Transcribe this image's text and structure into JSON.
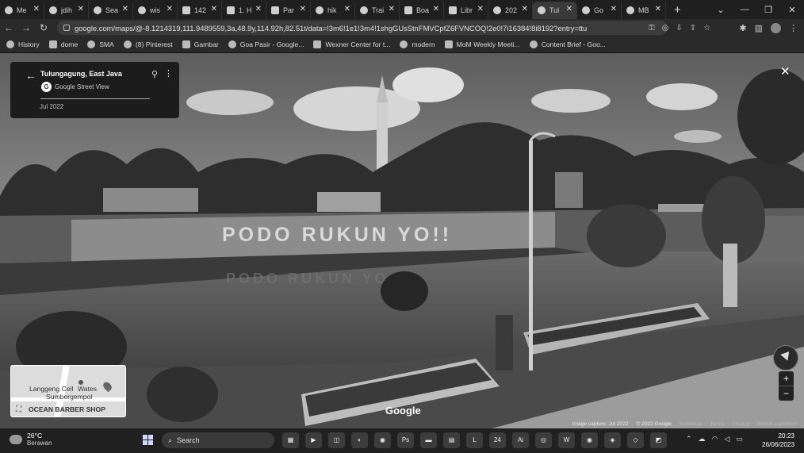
{
  "browser": {
    "tabs": [
      {
        "label": "Me",
        "icon": "google-icon"
      },
      {
        "label": "jdih",
        "icon": "site-icon"
      },
      {
        "label": "Sea",
        "icon": "site-icon"
      },
      {
        "label": "wis",
        "icon": "google-icon"
      },
      {
        "label": "142",
        "icon": "doc-icon"
      },
      {
        "label": "1. H",
        "icon": "site-icon"
      },
      {
        "label": "Par",
        "icon": "site-icon"
      },
      {
        "label": "hik",
        "icon": "google-icon"
      },
      {
        "label": "Trai",
        "icon": "site-icon"
      },
      {
        "label": "Boa",
        "icon": "board-icon"
      },
      {
        "label": "Libr",
        "icon": "library-icon"
      },
      {
        "label": "202",
        "icon": "site-icon"
      },
      {
        "label": "Tul",
        "icon": "maps-pin-icon",
        "active": true
      },
      {
        "label": "Go",
        "icon": "site-icon"
      },
      {
        "label": "MB",
        "icon": "google-icon"
      }
    ],
    "new_tab": "+",
    "url": "google.com/maps/@-8.1214319,111.9489559,3a,48.9y,114.92h,82.51t/data=!3m6!1e1!3m4!1shgGUsStnFMVCpfZ6FVNCOQ!2e0!7i16384!8i8192?entry=ttu",
    "bookmarks": [
      {
        "label": "History"
      },
      {
        "label": "dome"
      },
      {
        "label": "SMA"
      },
      {
        "label": "(8) Pinterest"
      },
      {
        "label": "Gambar"
      },
      {
        "label": "Goa Pasir - Google..."
      },
      {
        "label": "Wexner Center for t..."
      },
      {
        "label": "modern"
      },
      {
        "label": "MoM Weekly Meeti..."
      },
      {
        "label": "Content Brief - Goo..."
      }
    ]
  },
  "streetview": {
    "place": "Tulungagung, East Java",
    "source": "Google Street View",
    "date": "Jul 2022",
    "wall_text": "PODO RUKUN YO!!",
    "reflection_text": "PODO RUKUN YO",
    "logo": "Google",
    "footer": [
      "Image capture: Jul 2022",
      "© 2023 Google",
      "Indonesia",
      "Terms",
      "Privacy",
      "Report a problem"
    ]
  },
  "minimap": {
    "label1": "Langgeng Cell",
    "label2": "Wates",
    "label3": "Sumbergempol",
    "label4": "OCEAN BARBER SHOP"
  },
  "taskbar": {
    "temperature": "26°C",
    "weather": "Berawan",
    "search_placeholder": "Search",
    "time": "20:23",
    "date": "26/06/2023",
    "notif_badge": "24"
  }
}
